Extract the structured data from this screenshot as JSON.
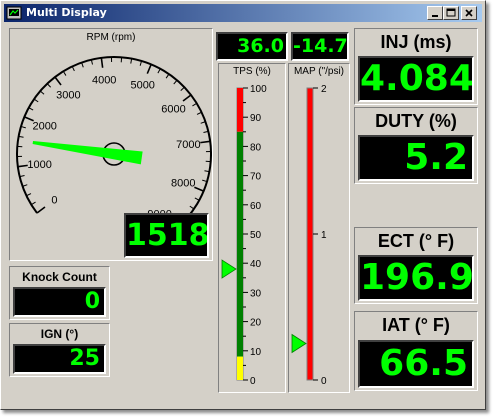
{
  "window": {
    "title": "Multi Display",
    "buttons": {
      "minimize": "_",
      "maximize": "□",
      "close": "×"
    }
  },
  "rpm": {
    "title": "RPM (rpm)",
    "value": "1518",
    "needle_value": 1518,
    "scale_min": 0,
    "scale_max": 9000,
    "tick_labels": [
      "0",
      "1000",
      "2000",
      "3000",
      "4000",
      "5000",
      "6000",
      "7000",
      "8000",
      "9000"
    ],
    "redline_from": 9000,
    "needle_color": "#00ff00",
    "redline_color": "#ff0000"
  },
  "readouts_top": {
    "left": "36.0",
    "right": "-14.7"
  },
  "tps": {
    "title": "TPS (%)",
    "tick_labels": [
      "100",
      "90",
      "80",
      "70",
      "60",
      "50",
      "40",
      "30",
      "20",
      "10",
      "0"
    ],
    "marker_value": 38,
    "fill_value": 8,
    "colors": {
      "high": "#ff0000",
      "mid": "#008000",
      "low": "#ffff00"
    }
  },
  "map": {
    "title": "MAP (\"/psi)",
    "tick_labels": [
      "2",
      "1",
      "0"
    ],
    "marker_value": 0.25,
    "bar_color": "#ff0000"
  },
  "knock": {
    "label": "Knock Count",
    "value": "0"
  },
  "ign": {
    "label": "IGN (°)",
    "value": "25"
  },
  "inj": {
    "label": "INJ (ms)",
    "value": "4.084"
  },
  "duty": {
    "label": "DUTY (%)",
    "value": "5.2"
  },
  "ect": {
    "label": "ECT (° F)",
    "value": "196.9"
  },
  "iat": {
    "label": "IAT (° F)",
    "value": "66.5"
  }
}
